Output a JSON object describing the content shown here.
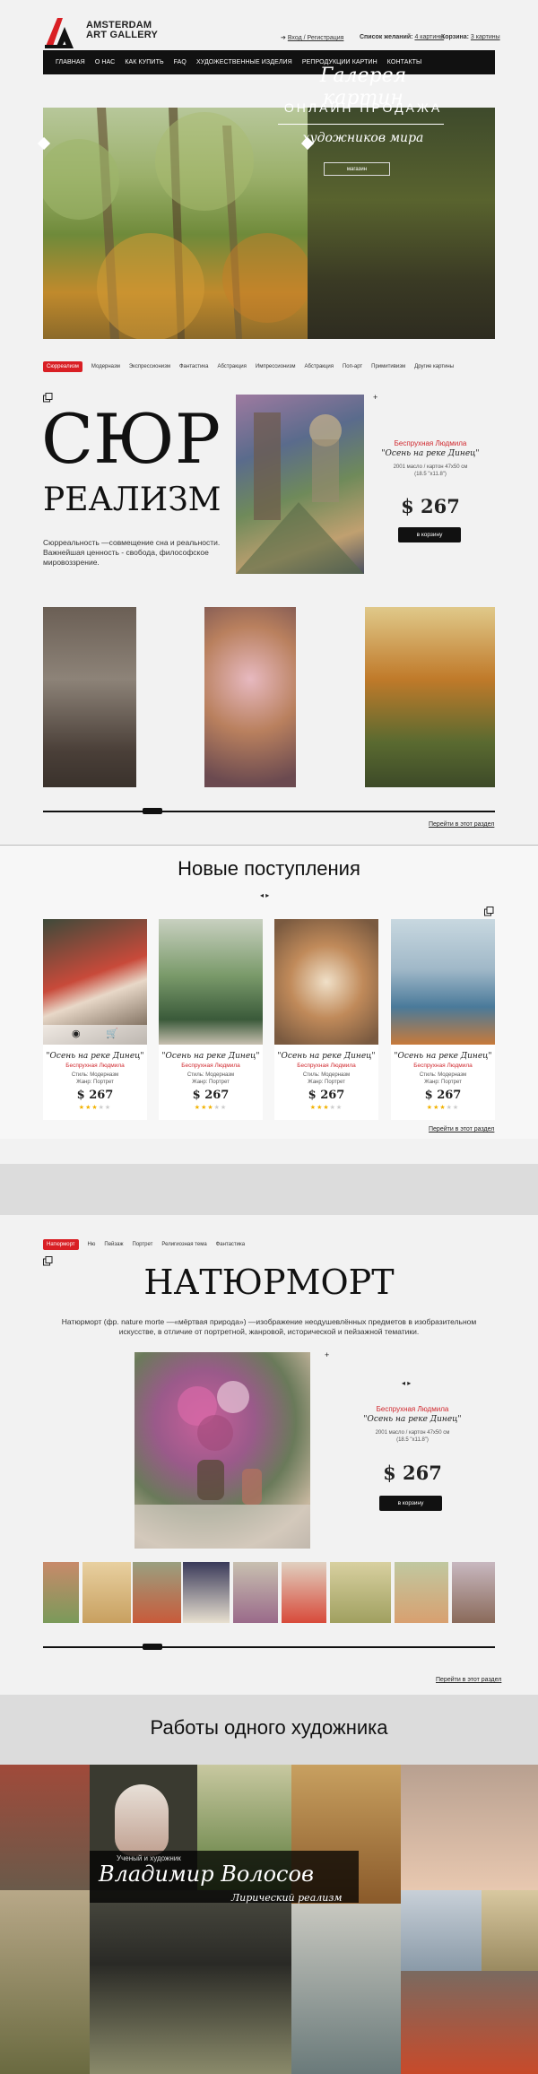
{
  "header": {
    "logo_line1": "AMSTERDAM",
    "logo_line2": "ART GALLERY",
    "login": "Вход / Регистрация",
    "wishlist_label": "Список желаний:",
    "wishlist_value": "4 картины",
    "cart_label": "Корзина:",
    "cart_value": "3 картины"
  },
  "nav": [
    "ГЛАВНАЯ",
    "О НАС",
    "КАК КУПИТЬ",
    "FAQ",
    "ХУДОЖЕСТВЕННЫЕ ИЗДЕЛИЯ",
    "РЕПРОДУКЦИИ КАРТИН",
    "КОНТАКТЫ"
  ],
  "hero": {
    "title": "Галерея картин",
    "subtitle": "ОНЛАЙН ПРОДАЖА",
    "subtitle2": "художников мира",
    "button": "магазин"
  },
  "genre_tabs": [
    "Сюрреализм",
    "Модерназм",
    "Экспрессионизм",
    "Фантастика",
    "Абстракция",
    "Импрессионизм",
    "Абстракция",
    "Поп-арт",
    "Примитивизм",
    "Другие картины"
  ],
  "surrealism": {
    "title_line1": "СЮР",
    "title_line2": "РЕАЛИЗМ",
    "description": "Сюрреальность —совмещение сна и реальности. Важнейшая ценность - свобода, философское мировоззрение.",
    "artist": "Беспрухная Людмила",
    "painting": "\"Осень на реке Динец\"",
    "info1": "2001 масло / картон 47x50 см",
    "info2": "(18.5 \"x11.8\")",
    "price": "$ 267",
    "cart_button": "в корзину",
    "section_link": "Перейти в этот раздел"
  },
  "new_arrivals": {
    "heading": "Новые поступления",
    "pager": "◂ ▸",
    "cards": [
      {
        "title": "\"Осень на реке Динец\"",
        "artist": "Беспрухная Людмила",
        "line1": "Стиль: Модерназм",
        "line2": "Жанр: Портрет",
        "price": "$ 267",
        "rating": 3
      },
      {
        "title": "\"Осень на реке Динец\"",
        "artist": "Беспрухная Людмила",
        "line1": "Стиль: Модерназм",
        "line2": "Жанр: Портрет",
        "price": "$ 267",
        "rating": 3
      },
      {
        "title": "\"Осень на реке Динец\"",
        "artist": "Беспрухная Людмила",
        "line1": "Стиль: Модерназм",
        "line2": "Жанр: Портрет",
        "price": "$ 267",
        "rating": 3
      },
      {
        "title": "\"Осень на реке Динец\"",
        "artist": "Беспрухная Людмила",
        "line1": "Стиль: Модерназм",
        "line2": "Жанр: Портрет",
        "price": "$ 267",
        "rating": 3
      }
    ],
    "section_link": "Перейти в этот раздел"
  },
  "still_life": {
    "tabs": [
      "Натюрморт",
      "Ню",
      "Пейзаж",
      "Портрет",
      "Религиозная тема",
      "Фантастика"
    ],
    "title": "НАТЮРМОРТ",
    "description": "Натюрморт (фр. nature morte —«мёртвая природа») —изображение неодушевлённых предметов в изобразительном искусстве, в отличие от портретной, жанровой, исторической и пейзажной тематики.",
    "artist": "Беспрухная Людмила",
    "painting": "\"Осень на реке Динец\"",
    "info1": "2001 масло / картон 47x50 см",
    "info2": "(18.5 \"x11.8\")",
    "price": "$ 267",
    "cart_button": "в корзину",
    "section_link": "Перейти в этот раздел"
  },
  "one_artist": {
    "heading": "Работы одного художника",
    "caption": "Ученый и художник",
    "name": "Владимир Волосов",
    "style": "Лирический реализм"
  },
  "colors": {
    "accent": "#d91f24",
    "dark": "#111111",
    "background": "#f2f2f2"
  }
}
